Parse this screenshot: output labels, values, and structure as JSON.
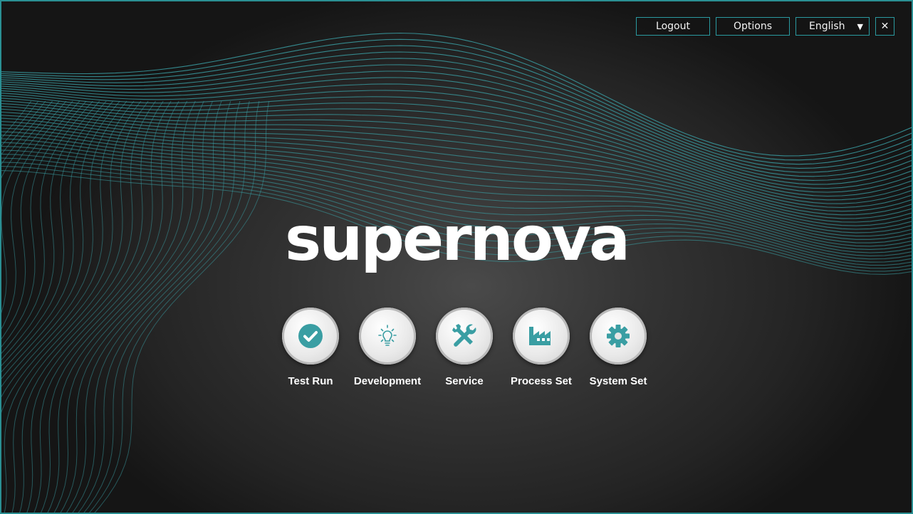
{
  "header": {
    "logout_label": "Logout",
    "options_label": "Options",
    "language": {
      "selected": "English"
    },
    "close_symbol": "✕"
  },
  "brand": {
    "logo_text": "supernova"
  },
  "apps": [
    {
      "label": "Test Run",
      "icon": "check-circle-icon"
    },
    {
      "label": "Development",
      "icon": "lightbulb-icon"
    },
    {
      "label": "Service",
      "icon": "tools-icon"
    },
    {
      "label": "Process Set",
      "icon": "factory-icon"
    },
    {
      "label": "System Set",
      "icon": "gear-icon"
    }
  ],
  "colors": {
    "accent": "#2a9aa0",
    "icon": "#3a9ea3",
    "background": "#2b2b2b",
    "text": "#ffffff"
  }
}
